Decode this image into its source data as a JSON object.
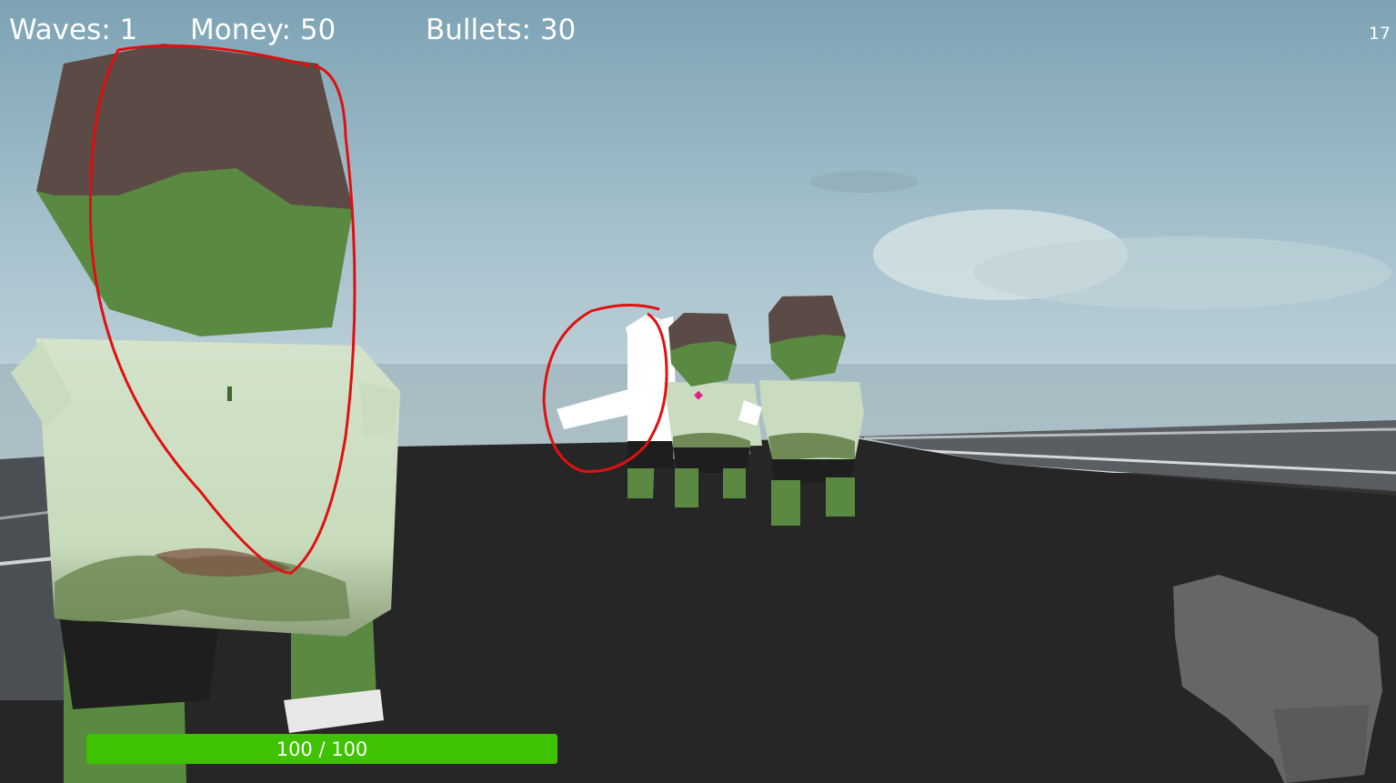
{
  "hud": {
    "waves_label": "Waves: 1",
    "money_label": "Money: 50",
    "bullets_label": "Bullets: 30",
    "fps": "17"
  },
  "health": {
    "text": "100 / 100",
    "fraction": 1.0,
    "color": "#3fc200"
  },
  "colors": {
    "ground": "#262626",
    "zombie_skin": "#5a8a41",
    "zombie_hair": "#5b4a45",
    "zombie_shirt": "#c9dcbf",
    "annotation_red": "#e01010",
    "gun": "#666666"
  }
}
